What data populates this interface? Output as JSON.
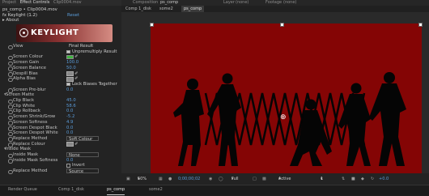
{
  "left_panel": {
    "tabs": [
      "Project",
      "Effect Controls",
      "Clip0004.mov"
    ],
    "comp_label": "ps_comp • Clip0004.mov",
    "effect": {
      "name": "fx  Keylight (1.2)",
      "reset": "Reset",
      "about": "About"
    },
    "logo_text": "KEYLIGHT",
    "rows": [
      {
        "label": "View",
        "value": "Final Result",
        "kind": "text"
      },
      {
        "label": "",
        "value": "Unpremultiply Result",
        "kind": "check_on"
      },
      {
        "label": "Screen Colour",
        "value": "",
        "kind": "swatch"
      },
      {
        "label": "Screen Gain",
        "value": "100.0",
        "kind": "num"
      },
      {
        "label": "Screen Balance",
        "value": "50.0",
        "kind": "num"
      },
      {
        "label": "Despill Bias",
        "value": "",
        "kind": "swatch_gray"
      },
      {
        "label": "Alpha Bias",
        "value": "",
        "kind": "swatch_gray"
      },
      {
        "label": "",
        "value": "Lock Biases Together",
        "kind": "check_on"
      },
      {
        "label": "Screen Pre-blur",
        "value": "0.0",
        "kind": "num"
      },
      {
        "label": "Screen Matte",
        "value": "",
        "kind": "section"
      },
      {
        "label": "Clip Black",
        "value": "45.0",
        "kind": "num"
      },
      {
        "label": "Clip White",
        "value": "58.6",
        "kind": "num"
      },
      {
        "label": "Clip Rollback",
        "value": "0.0",
        "kind": "num"
      },
      {
        "label": "Screen Shrink/Grow",
        "value": "-5.2",
        "kind": "num"
      },
      {
        "label": "Screen Softness",
        "value": "4.9",
        "kind": "num"
      },
      {
        "label": "Screen Despot Black",
        "value": "0.0",
        "kind": "num"
      },
      {
        "label": "Screen Despot White",
        "value": "0.0",
        "kind": "num"
      },
      {
        "label": "Replace Method",
        "value": "Soft Colour",
        "kind": "select"
      },
      {
        "label": "Replace Colour",
        "value": "",
        "kind": "swatch_gray"
      },
      {
        "label": "Inside Mask",
        "value": "",
        "kind": "section"
      },
      {
        "label": "Inside Mask",
        "value": "None",
        "kind": "select"
      },
      {
        "label": "Inside Mask Softness",
        "value": "0.0",
        "kind": "num"
      },
      {
        "label": "",
        "value": "Invert",
        "kind": "check_off"
      },
      {
        "label": "Replace Method",
        "value": "Source",
        "kind": "select"
      }
    ]
  },
  "viewer": {
    "top_tabs": [
      "Composition",
      "ps_comp",
      "Layer",
      "(none)",
      "Footage",
      "(none)"
    ],
    "breadcrumbs": [
      "Comp 1_disk",
      "some2",
      "ps_comp"
    ],
    "background_color": "#840505",
    "toolbar": {
      "zoom": "50%",
      "timecode": "0;00;00;02",
      "quality": "Full",
      "camera": "Active Camera",
      "views": "1 View",
      "exposure": "+0.0"
    }
  },
  "bottom_tabs": [
    "Render Queue",
    "Comp 1_disk",
    "ps_comp",
    "some2"
  ],
  "active_bottom_tab": 2
}
